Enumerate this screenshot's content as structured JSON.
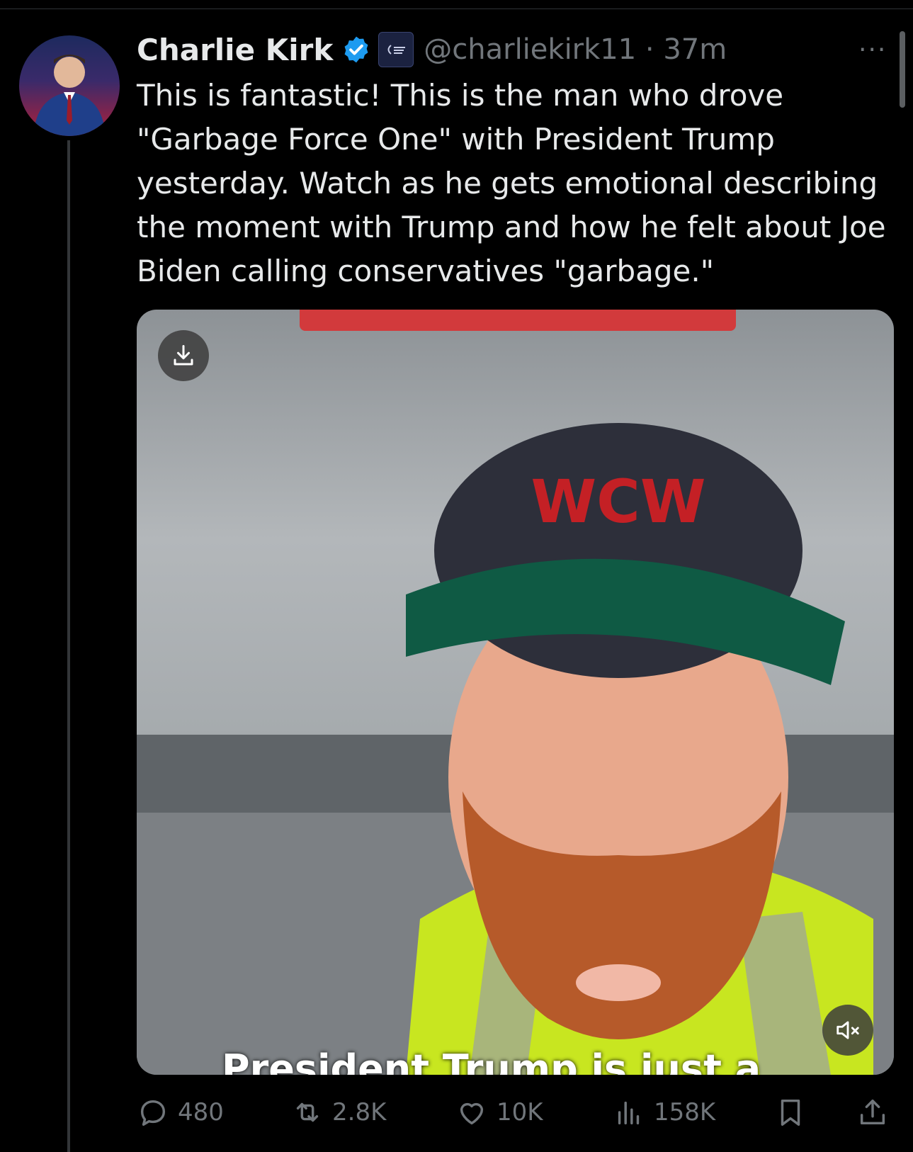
{
  "tweet": {
    "author_name": "Charlie Kirk",
    "handle_time": "@charliekirk11 · 37m",
    "text": "This is fantastic! This is the man who drove \"Garbage Force One\" with President Trump yesterday. Watch as he gets emotional describing the moment with Trump and how he felt about Joe Biden calling conservatives \"garbage.\"",
    "more_label": "···"
  },
  "media": {
    "caption": "President Trump is just a",
    "hat_logo": "WCW"
  },
  "actions": {
    "replies": "480",
    "reposts": "2.8K",
    "likes": "10K",
    "views": "158K"
  },
  "colors": {
    "background": "#000000",
    "text": "#e7e9ea",
    "secondary": "#71767b",
    "verified": "#1d9bf0"
  }
}
